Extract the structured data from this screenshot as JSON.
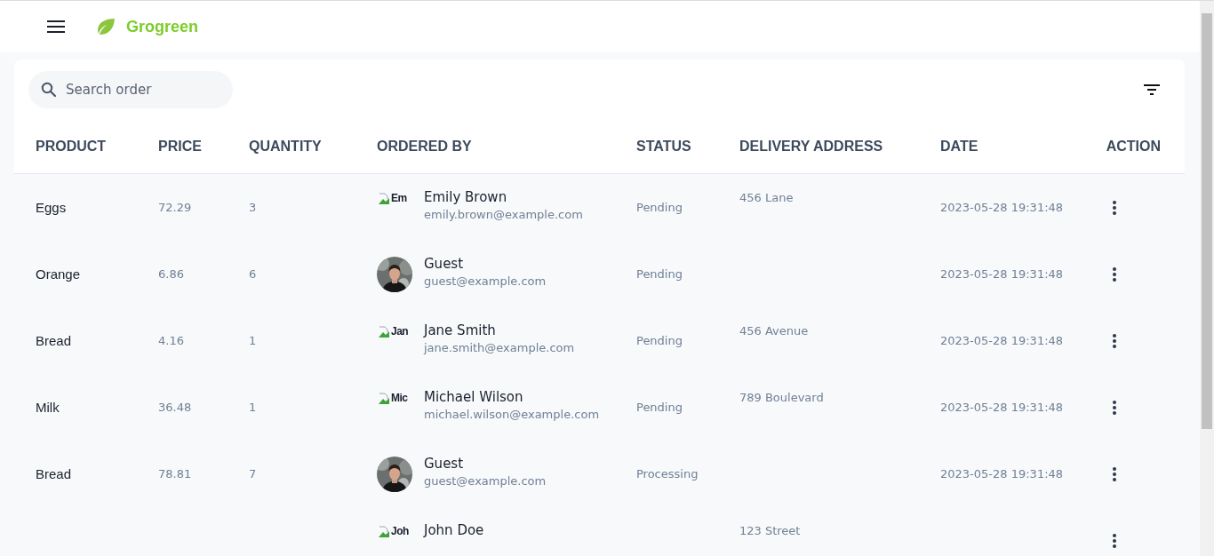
{
  "app": {
    "brand": "Grogreen"
  },
  "search": {
    "placeholder": "Search order"
  },
  "table": {
    "columns": [
      "PRODUCT",
      "PRICE",
      "QUANTITY",
      "ORDERED BY",
      "STATUS",
      "DELIVERY ADDRESS",
      "DATE",
      "ACTION"
    ],
    "rows": [
      {
        "product": "Eggs",
        "price": "72.29",
        "quantity": "3",
        "avatar": {
          "kind": "broken",
          "alt": "Em"
        },
        "name": "Emily Brown",
        "email": "emily.brown@example.com",
        "status": "Pending",
        "address": "456 Lane",
        "date": "2023-05-28 19:31:48"
      },
      {
        "product": "Orange",
        "price": "6.86",
        "quantity": "6",
        "name": "Guest",
        "email": "guest@example.com",
        "status": "Pending",
        "address": "",
        "date": "2023-05-28 19:31:48"
      },
      {
        "product": "Bread",
        "price": "4.16",
        "quantity": "1",
        "avatar": {
          "kind": "broken",
          "alt": "Jan"
        },
        "name": "Jane Smith",
        "email": "jane.smith@example.com",
        "status": "Pending",
        "address": "456 Avenue",
        "date": "2023-05-28 19:31:48"
      },
      {
        "product": "Milk",
        "price": "36.48",
        "quantity": "1",
        "avatar": {
          "kind": "broken",
          "alt": "Mic"
        },
        "name": "Michael Wilson",
        "email": "michael.wilson@example.com",
        "status": "Pending",
        "address": "789 Boulevard",
        "date": "2023-05-28 19:31:48"
      },
      {
        "product": "Bread",
        "price": "78.81",
        "quantity": "7",
        "name": "Guest",
        "email": "guest@example.com",
        "status": "Processing",
        "address": "",
        "date": "2023-05-28 19:31:48"
      },
      {
        "avatar": {
          "kind": "broken",
          "alt": "Joh"
        },
        "name": "John Doe",
        "address": "123 Street"
      }
    ]
  }
}
